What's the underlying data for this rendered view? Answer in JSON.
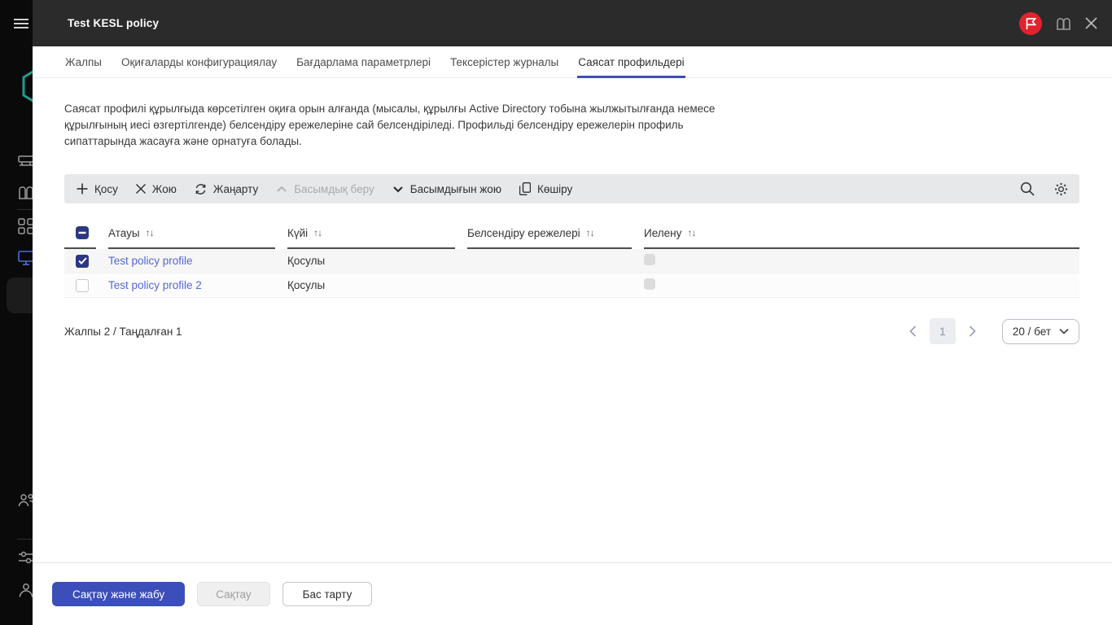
{
  "colors": {
    "accent": "#3f4eb8",
    "link_blue": "#5468d4",
    "checkbox_blue": "#2b3883",
    "badge_red": "#e0232e",
    "header_dark": "#2b2b2b",
    "toolbar_gray": "#e7e8ea"
  },
  "window": {
    "title": "Test KESL policy"
  },
  "tabs": [
    {
      "label": "Жалпы"
    },
    {
      "label": "Оқиғаларды конфигурациялау"
    },
    {
      "label": "Бағдарлама параметрлері"
    },
    {
      "label": "Тексерістер журналы"
    },
    {
      "label": "Саясат профильдері"
    }
  ],
  "description": "Саясат профилі құрылғыда көрсетілген оқиға орын алғанда (мысалы, құрылғы Active Directory тобына жылжытылғанда немесе құрылғының иесі өзгертілгенде) белсендіру ережелеріне сай белсендіріледі. Профильді белсендіру ережелерін профиль сипаттарында жасауға және орнатуға болады.",
  "toolbar": {
    "add": "Қосу",
    "delete": "Жою",
    "refresh": "Жаңарту",
    "prioritize": "Басымдық беру",
    "deprioritize": "Басымдығын жою",
    "copy": "Көшіру"
  },
  "icons": {
    "sort": "↑↓"
  },
  "table": {
    "columns": {
      "name": "Атауы",
      "status": "Күйі",
      "activation_rules": "Белсендіру ережелері",
      "inheritance": "Иелену"
    },
    "rows": [
      {
        "name": "Test policy profile",
        "status": "Қосулы"
      },
      {
        "name": "Test policy profile 2",
        "status": "Қосулы"
      }
    ]
  },
  "footer": {
    "summary": "Жалпы 2 / Таңдалған 1",
    "page": "1",
    "page_size": "20 / бет"
  },
  "actions": {
    "save_and_close": "Сақтау және жабу",
    "save": "Сақтау",
    "cancel": "Бас тарту"
  }
}
